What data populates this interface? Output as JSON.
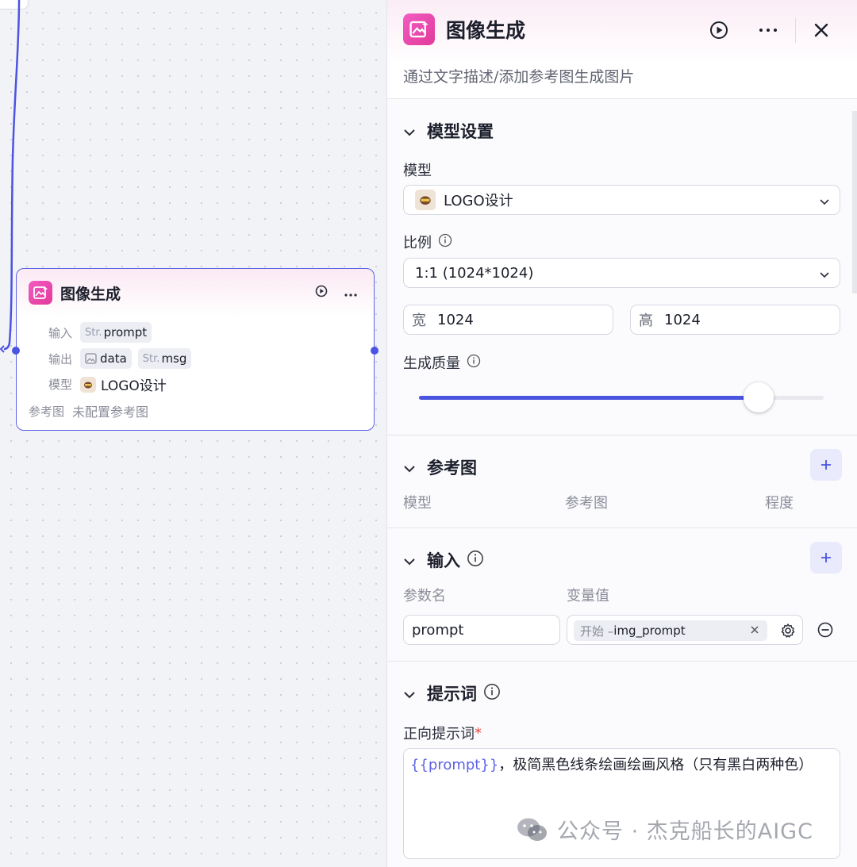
{
  "node": {
    "title": "图像生成",
    "rows": {
      "input": {
        "label": "输入",
        "params": [
          {
            "type": "Str.",
            "name": "prompt"
          }
        ]
      },
      "output": {
        "label": "输出",
        "params": [
          {
            "type": "img",
            "name": "data"
          },
          {
            "type": "Str.",
            "name": "msg"
          }
        ]
      },
      "model": {
        "label": "模型",
        "value": "LOGO设计"
      },
      "reference": {
        "label": "参考图",
        "value": "未配置参考图"
      }
    }
  },
  "panel": {
    "title": "图像生成",
    "description": "通过文字描述/添加参考图生成图片",
    "model_settings": {
      "title": "模型设置",
      "model_label": "模型",
      "model_value": "LOGO设计",
      "ratio_label": "比例",
      "ratio_value": "1:1 (1024*1024)",
      "width_prefix": "宽",
      "width_value": "1024",
      "height_prefix": "高",
      "height_value": "1024",
      "quality_label": "生成质量",
      "quality_fraction": 0.84
    },
    "reference": {
      "title": "参考图",
      "columns": [
        "模型",
        "参考图",
        "程度"
      ]
    },
    "input": {
      "title": "输入",
      "columns": [
        "参数名",
        "变量值"
      ],
      "param_name": "prompt",
      "var_source": "开始 – ",
      "var_name": "img_prompt"
    },
    "prompt": {
      "title": "提示词",
      "positive_label": "正向提示词",
      "required_mark": "*",
      "token": "{{prompt}}",
      "text": "，极简黑色线条绘画绘画风格（只有黑白两种色）"
    }
  },
  "watermark": "公众号 · 杰克船长的AIGC",
  "colors": {
    "accent": "#4b54e0",
    "node_border": "#5d63e6",
    "app_icon": "#e23a9a",
    "required": "#e8473d"
  }
}
